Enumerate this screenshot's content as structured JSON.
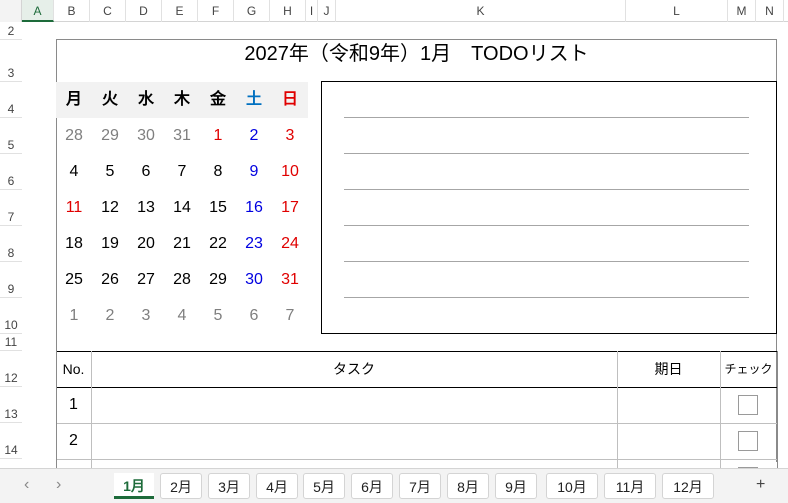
{
  "columns": [
    {
      "label": "A",
      "w": 32
    },
    {
      "label": "B",
      "w": 36
    },
    {
      "label": "C",
      "w": 36
    },
    {
      "label": "D",
      "w": 36
    },
    {
      "label": "E",
      "w": 36
    },
    {
      "label": "F",
      "w": 36
    },
    {
      "label": "G",
      "w": 36
    },
    {
      "label": "H",
      "w": 36
    },
    {
      "label": "I",
      "w": 12
    },
    {
      "label": "J",
      "w": 18
    },
    {
      "label": "K",
      "w": 290
    },
    {
      "label": "L",
      "w": 102
    },
    {
      "label": "M",
      "w": 28
    },
    {
      "label": "N",
      "w": 28
    }
  ],
  "rows": [
    "2",
    "3",
    "4",
    "5",
    "6",
    "7",
    "8",
    "9",
    "10",
    "11",
    "12",
    "13",
    "14"
  ],
  "title": "2027年（令和9年）1月　TODOリスト",
  "weekdays": [
    {
      "label": "月",
      "color": "#000000"
    },
    {
      "label": "火",
      "color": "#000000"
    },
    {
      "label": "水",
      "color": "#000000"
    },
    {
      "label": "木",
      "color": "#000000"
    },
    {
      "label": "金",
      "color": "#000000"
    },
    {
      "label": "土",
      "color": "#0070c0"
    },
    {
      "label": "日",
      "color": "#e00000"
    }
  ],
  "calendar": [
    [
      {
        "d": "28",
        "c": "#7f7f7f"
      },
      {
        "d": "29",
        "c": "#7f7f7f"
      },
      {
        "d": "30",
        "c": "#7f7f7f"
      },
      {
        "d": "31",
        "c": "#7f7f7f"
      },
      {
        "d": "1",
        "c": "#e00000"
      },
      {
        "d": "2",
        "c": "#0000e0"
      },
      {
        "d": "3",
        "c": "#e00000"
      }
    ],
    [
      {
        "d": "4",
        "c": "#000000"
      },
      {
        "d": "5",
        "c": "#000000"
      },
      {
        "d": "6",
        "c": "#000000"
      },
      {
        "d": "7",
        "c": "#000000"
      },
      {
        "d": "8",
        "c": "#000000"
      },
      {
        "d": "9",
        "c": "#0000e0"
      },
      {
        "d": "10",
        "c": "#e00000"
      }
    ],
    [
      {
        "d": "11",
        "c": "#e00000"
      },
      {
        "d": "12",
        "c": "#000000"
      },
      {
        "d": "13",
        "c": "#000000"
      },
      {
        "d": "14",
        "c": "#000000"
      },
      {
        "d": "15",
        "c": "#000000"
      },
      {
        "d": "16",
        "c": "#0000e0"
      },
      {
        "d": "17",
        "c": "#e00000"
      }
    ],
    [
      {
        "d": "18",
        "c": "#000000"
      },
      {
        "d": "19",
        "c": "#000000"
      },
      {
        "d": "20",
        "c": "#000000"
      },
      {
        "d": "21",
        "c": "#000000"
      },
      {
        "d": "22",
        "c": "#000000"
      },
      {
        "d": "23",
        "c": "#0000e0"
      },
      {
        "d": "24",
        "c": "#e00000"
      }
    ],
    [
      {
        "d": "25",
        "c": "#000000"
      },
      {
        "d": "26",
        "c": "#000000"
      },
      {
        "d": "27",
        "c": "#000000"
      },
      {
        "d": "28",
        "c": "#000000"
      },
      {
        "d": "29",
        "c": "#000000"
      },
      {
        "d": "30",
        "c": "#0000e0"
      },
      {
        "d": "31",
        "c": "#e00000"
      }
    ],
    [
      {
        "d": "1",
        "c": "#7f7f7f"
      },
      {
        "d": "2",
        "c": "#7f7f7f"
      },
      {
        "d": "3",
        "c": "#7f7f7f"
      },
      {
        "d": "4",
        "c": "#7f7f7f"
      },
      {
        "d": "5",
        "c": "#7f7f7f"
      },
      {
        "d": "6",
        "c": "#7f7f7f"
      },
      {
        "d": "7",
        "c": "#7f7f7f"
      }
    ]
  ],
  "memo_line_count": 6,
  "table": {
    "headers": {
      "no": "No.",
      "task": "タスク",
      "due": "期日",
      "check": "チェック"
    },
    "rows": [
      {
        "no": "1",
        "task": "",
        "due": "",
        "checked": false
      },
      {
        "no": "2",
        "task": "",
        "due": "",
        "checked": false
      }
    ]
  },
  "sheet_tabs": [
    "1月",
    "2月",
    "3月",
    "4月",
    "5月",
    "6月",
    "7月",
    "8月",
    "9月",
    "10月",
    "11月",
    "12月"
  ],
  "active_tab": "1月",
  "tab_nav": {
    "prev": "‹",
    "next": "›",
    "add": "+"
  }
}
